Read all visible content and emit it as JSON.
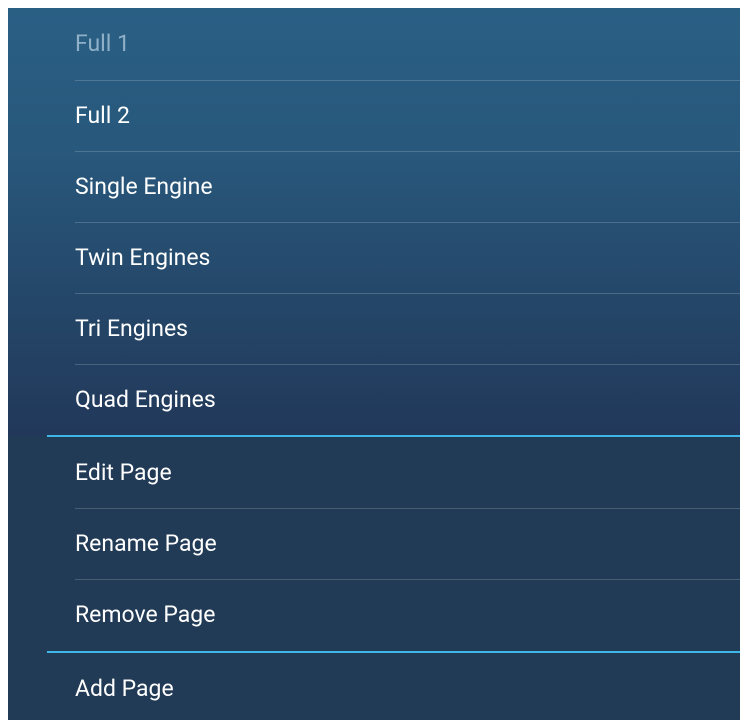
{
  "menu": {
    "pages": [
      {
        "label": "Full 1",
        "state": "current"
      },
      {
        "label": "Full 2"
      },
      {
        "label": "Single Engine"
      },
      {
        "label": "Twin Engines"
      },
      {
        "label": "Tri Engines"
      },
      {
        "label": "Quad Engines"
      }
    ],
    "actions": [
      {
        "label": "Edit Page"
      },
      {
        "label": "Rename Page"
      },
      {
        "label": "Remove Page"
      }
    ],
    "footer": {
      "label": "Add Page"
    }
  },
  "colors": {
    "accent": "#3fb6e6",
    "panel_top": "#2a5f84",
    "panel_bottom": "#213a55",
    "dim_text": "#8fb0c8"
  }
}
